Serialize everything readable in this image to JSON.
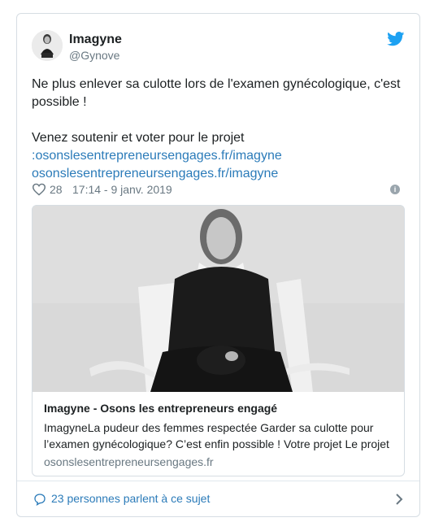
{
  "user": {
    "name": "Imagyne",
    "handle": "@Gynove"
  },
  "tweet": {
    "line1": "Ne plus enlever sa culotte lors de l'examen gynécologique, c'est possible !",
    "line2": "Venez soutenir et voter pour le projet",
    "link1": ":osonslesentrepreneursengages.fr/imagyne",
    "link2": "osonslesentrepreneursengages.fr/imagyne"
  },
  "meta": {
    "likes": "28",
    "timestamp": "17:14 - 9 janv. 2019",
    "info_glyph": "i"
  },
  "card": {
    "title": "Imagyne - Osons les entrepreneurs engagé",
    "description": "ImagyneLa pudeur des femmes respectée Garder sa culotte pour l’examen gynécologique? C’est enfin possible ! Votre projet Le projet",
    "domain": "osonslesentrepreneursengages.fr"
  },
  "footer": {
    "label": "23 personnes parlent à ce sujet"
  },
  "colors": {
    "link": "#2b7bb9",
    "muted": "#697882",
    "twitter_blue": "#1da1f2",
    "border": "#d6dde3"
  },
  "icons": [
    "twitter-bird-icon",
    "heart-icon",
    "info-icon",
    "comment-bubble-icon",
    "chevron-right-icon"
  ]
}
